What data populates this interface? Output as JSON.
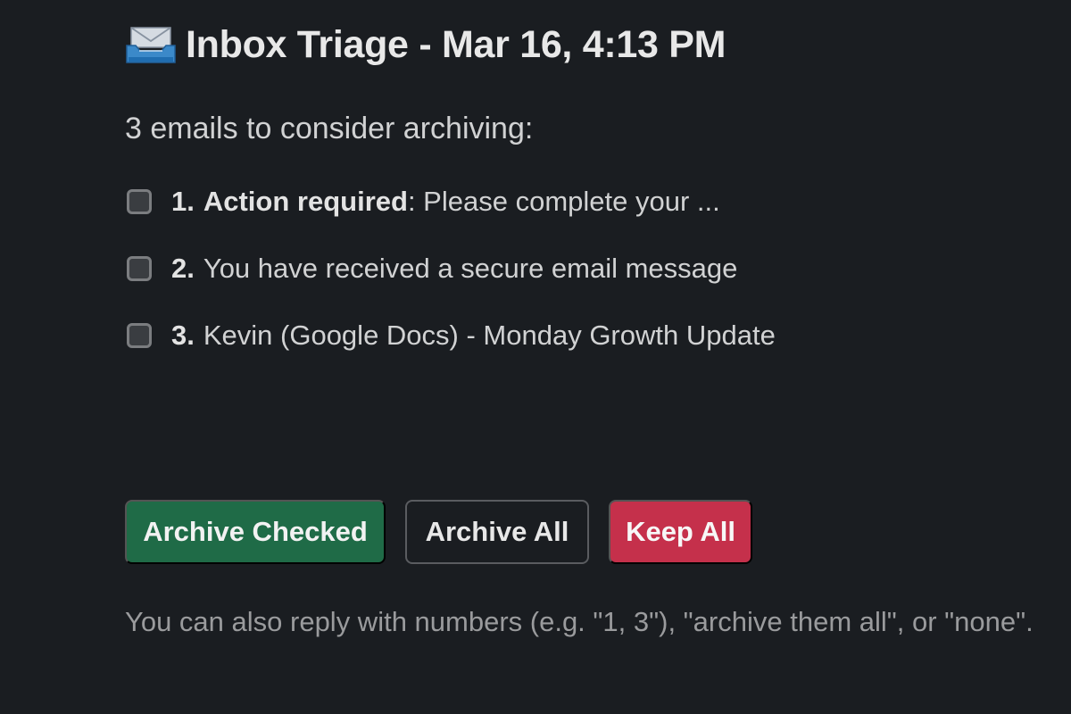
{
  "message": {
    "icon": "inbox-tray-icon",
    "title": "Inbox Triage - Mar 16, 4:13 PM",
    "intro": "3 emails to consider archiving:",
    "emails": [
      {
        "number": "1.",
        "bold_text": "Action required",
        "text": ": Please complete your ..."
      },
      {
        "number": "2.",
        "bold_text": "",
        "text": "You have received a secure email message"
      },
      {
        "number": "3.",
        "bold_text": "",
        "text": "Kevin (Google Docs) - Monday Growth Update"
      }
    ],
    "buttons": {
      "archive_checked": "Archive Checked",
      "archive_all": "Archive All",
      "keep_all": "Keep All"
    },
    "hint": "You can also reply with numbers (e.g. \"1, 3\"), \"archive them all\", or \"none\"."
  },
  "colors": {
    "background": "#1a1d21",
    "primary_button": "#1f6b47",
    "danger_button": "#c5304b",
    "text": "#d1d2d3",
    "muted_text": "#9a9b9d"
  }
}
